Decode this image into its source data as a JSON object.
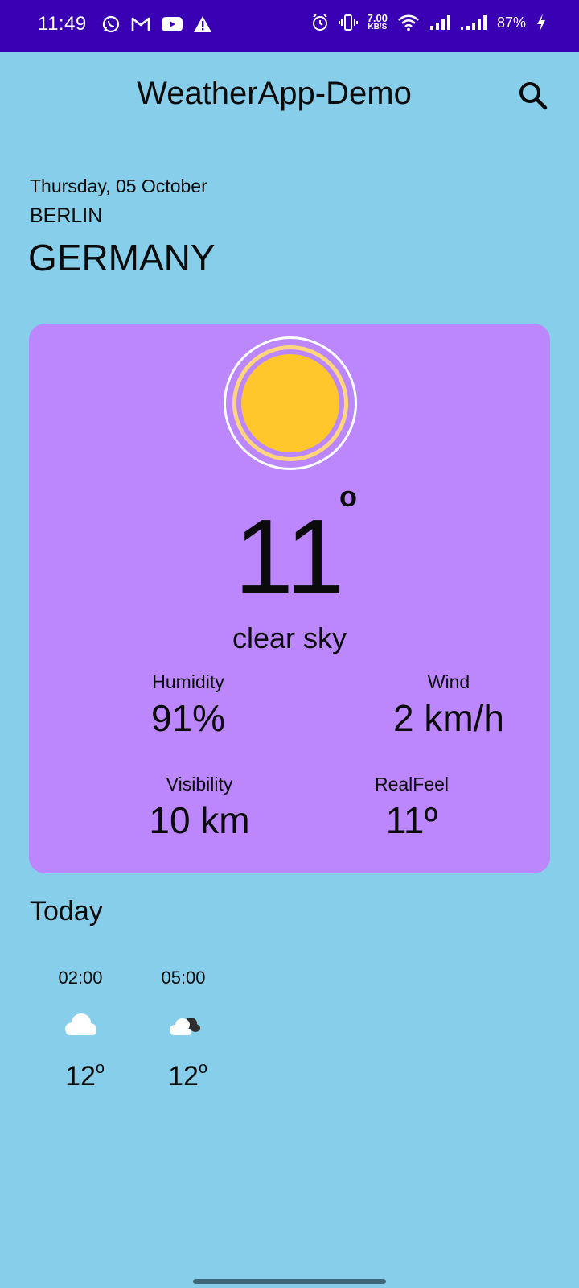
{
  "status_bar": {
    "time": "11:49",
    "net_speed_value": "7.00",
    "net_speed_unit": "KB/S",
    "battery": "87%",
    "color": "#3a00b3"
  },
  "app_bar": {
    "title": "WeatherApp-Demo"
  },
  "location": {
    "date": "Thursday, 05 October",
    "city": "BERLIN",
    "country": "GERMANY"
  },
  "current": {
    "temperature": "11",
    "degree_symbol": "o",
    "condition": "clear sky",
    "card_color": "#bc86fd",
    "sun_color": "#ffc72c",
    "stats": {
      "humidity_label": "Humidity",
      "humidity_value": "91%",
      "wind_label": "Wind",
      "wind_value": "2 km/h",
      "visibility_label": "Visibility",
      "visibility_value": "10 km",
      "realfeel_label": "RealFeel",
      "realfeel_value": "11º"
    }
  },
  "today": {
    "title": "Today",
    "hours": [
      {
        "time": "02:00",
        "icon": "cloud-icon",
        "temp": "12",
        "deg": "o"
      },
      {
        "time": "05:00",
        "icon": "cloudy-night-icon",
        "temp": "12",
        "deg": "o"
      }
    ]
  },
  "background_color": "#87CEEB"
}
